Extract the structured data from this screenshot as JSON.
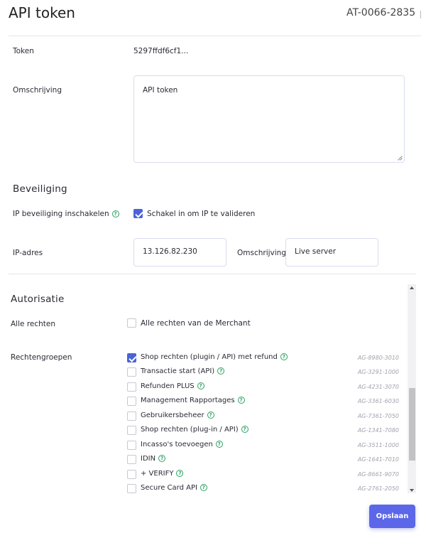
{
  "header": {
    "title": "API token",
    "token_id": "AT-0066-2835"
  },
  "details": {
    "token_label": "Token",
    "token_value": "5297ffdf6cf1...",
    "description_label": "Omschrijving",
    "description_value": "API token"
  },
  "security": {
    "heading": "Beveiliging",
    "ip_enable_label": "IP beveiliging inschakelen",
    "ip_enable_checkbox_label": "Schakel in om IP te valideren",
    "ip_enable_checked": true,
    "ip_label": "IP-adres",
    "ip_value": "13.126.82.230",
    "ip_description_label": "Omschrijving",
    "ip_description_value": "Live server"
  },
  "authorization": {
    "heading": "Autorisatie",
    "all_rights_label": "Alle rechten",
    "all_rights_checkbox_label": "Alle rechten van de Merchant",
    "all_rights_checked": false,
    "groups_label": "Rechtengroepen",
    "groups": [
      {
        "label": "Shop rechten (plugin / API) met refund",
        "code": "AG-8980-3010",
        "checked": true,
        "help": true
      },
      {
        "label": "Transactie start (API)",
        "code": "AG-3291-1000",
        "checked": false,
        "help": true
      },
      {
        "label": "Refunden PLUS",
        "code": "AG-4231-3070",
        "checked": false,
        "help": true
      },
      {
        "label": "Management Rapportages",
        "code": "AG-3361-6030",
        "checked": false,
        "help": true
      },
      {
        "label": "Gebruikersbeheer",
        "code": "AG-7361-7050",
        "checked": false,
        "help": true
      },
      {
        "label": "Shop rechten (plug-in / API)",
        "code": "AG-1341-7080",
        "checked": false,
        "help": true
      },
      {
        "label": "Incasso's toevoegen",
        "code": "AG-3511-1000",
        "checked": false,
        "help": true
      },
      {
        "label": "IDIN",
        "code": "AG-1641-7010",
        "checked": false,
        "help": true
      },
      {
        "label": "+ VERIFY",
        "code": "AG-8661-9070",
        "checked": false,
        "help": true
      },
      {
        "label": "Secure Card API",
        "code": "AG-2761-2050",
        "checked": false,
        "help": true
      }
    ]
  },
  "actions": {
    "save_label": "Opslaan"
  },
  "colors": {
    "accent": "#5b67e8",
    "checkbox_checked": "#4a63d8",
    "help_icon": "#2aa162"
  },
  "icons": {
    "help": "question-circle-icon",
    "check": "checkmark-icon"
  }
}
